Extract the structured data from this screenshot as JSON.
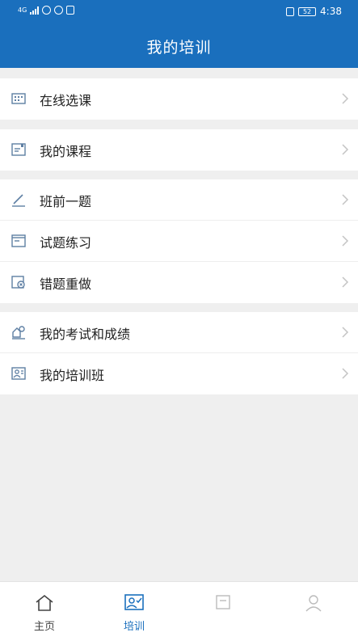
{
  "status_bar": {
    "network_label": "4G",
    "battery": "52",
    "time": "4:38"
  },
  "header": {
    "title": "我的培训"
  },
  "menu_groups": [
    {
      "items": [
        {
          "label": "在线选课",
          "icon": "course-grid-icon"
        }
      ]
    },
    {
      "items": [
        {
          "label": "我的课程",
          "icon": "my-course-icon"
        }
      ]
    },
    {
      "items": [
        {
          "label": "班前一题",
          "icon": "pencil-icon"
        },
        {
          "label": "试题练习",
          "icon": "exercise-icon"
        },
        {
          "label": "错题重做",
          "icon": "wrong-redo-icon"
        }
      ]
    },
    {
      "items": [
        {
          "label": "我的考试和成绩",
          "icon": "exam-score-icon"
        },
        {
          "label": "我的培训班",
          "icon": "training-class-icon"
        }
      ]
    }
  ],
  "tab_bar": {
    "active_color": "#1a6fbd",
    "inactive_color": "#444444",
    "tabs": [
      {
        "label": "主页",
        "icon": "home-icon",
        "active": false
      },
      {
        "label": "培训",
        "icon": "training-icon",
        "active": true
      },
      {
        "label": "",
        "icon": "message-icon",
        "active": false
      },
      {
        "label": "",
        "icon": "profile-icon",
        "active": false
      }
    ]
  }
}
